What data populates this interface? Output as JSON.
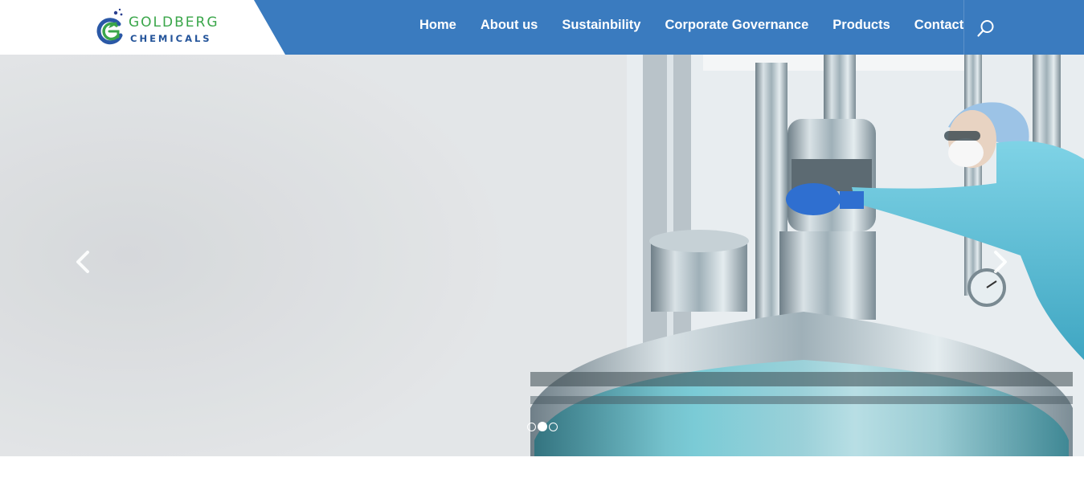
{
  "brand": {
    "name_line1": "GOLDBERG",
    "name_line2": "CHEMICALS",
    "primary_color": "#3a7bbf",
    "green": "#3aa64a",
    "navy": "#24549a"
  },
  "nav": {
    "items": [
      {
        "label": "Home"
      },
      {
        "label": "About us"
      },
      {
        "label": "Sustainbility"
      },
      {
        "label": "Corporate Governance"
      },
      {
        "label": "Products"
      },
      {
        "label": "Contact"
      }
    ],
    "search_icon": "search-icon"
  },
  "slider": {
    "prev_icon": "chevron-left-icon",
    "next_icon": "chevron-right-icon",
    "slide_count": 3,
    "active_index": 1
  }
}
